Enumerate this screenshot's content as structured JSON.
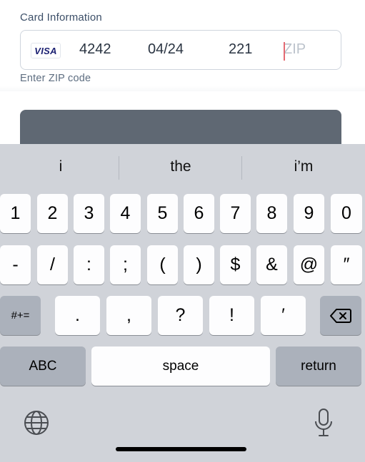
{
  "form": {
    "section_label": "Card Information",
    "card": {
      "brand": "VISA",
      "number": "4242",
      "expiry": "04/24",
      "cvc": "221",
      "zip_placeholder": "ZIP"
    },
    "helper_text": "Enter ZIP code"
  },
  "keyboard": {
    "suggestions": [
      "i",
      "the",
      "i’m"
    ],
    "row1": [
      "1",
      "2",
      "3",
      "4",
      "5",
      "6",
      "7",
      "8",
      "9",
      "0"
    ],
    "row2": [
      "-",
      "/",
      ":",
      ";",
      "(",
      ")",
      "$",
      "&",
      "@",
      "″"
    ],
    "row3": {
      "mode_key": "#+=",
      "keys": [
        ".",
        ",",
        "?",
        "!",
        "′"
      ]
    },
    "bottom": {
      "abc": "ABC",
      "space": "space",
      "return": "return"
    }
  }
}
